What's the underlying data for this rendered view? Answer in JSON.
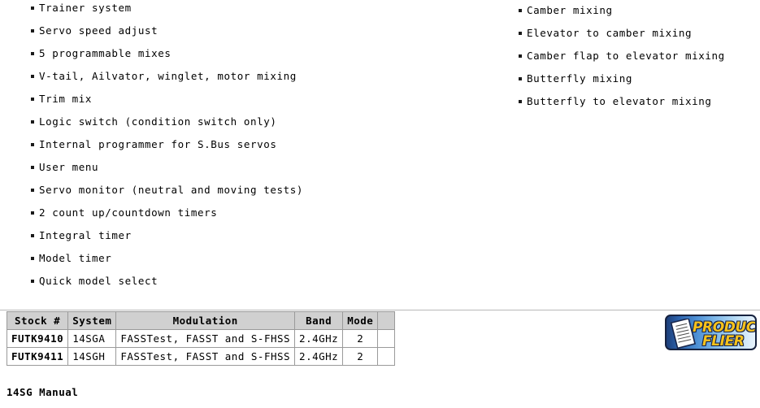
{
  "features": {
    "left_column": [
      "Trainer system",
      "Servo speed adjust",
      "5 programmable mixes",
      "V-tail, Ailvator, winglet, motor mixing",
      "Trim mix",
      "Logic switch (condition switch only)",
      "Internal programmer for S.Bus servos",
      "User menu",
      "Servo monitor (neutral and moving tests)",
      "2 count up/countdown timers",
      "Integral timer",
      "Model timer",
      "Quick model select"
    ],
    "right_column": [
      "Camber mixing",
      "Elevator to camber mixing",
      "Camber flap to elevator mixing",
      "Butterfly mixing",
      "Butterfly to elevator mixing"
    ]
  },
  "spec_table": {
    "headers": [
      "Stock #",
      "System",
      "Modulation",
      "Band",
      "Mode",
      ""
    ],
    "rows": [
      {
        "stock": "FUTK9410",
        "system": "14SGA",
        "modulation": "FASSTest, FASST and S-FHSS",
        "band": "2.4GHz",
        "mode": "2",
        "extra": ""
      },
      {
        "stock": "FUTK9411",
        "system": "14SGH",
        "modulation": "FASSTest, FASST and S-FHSS",
        "band": "2.4GHz",
        "mode": "2",
        "extra": ""
      }
    ]
  },
  "product_flier": {
    "line1": "PRODUCT",
    "line2": "FLIER",
    "icon": "document-icon",
    "accent_color": "#f7c21b",
    "outline_color": "#18254a"
  },
  "footer": {
    "caption": "14SG Manual"
  }
}
